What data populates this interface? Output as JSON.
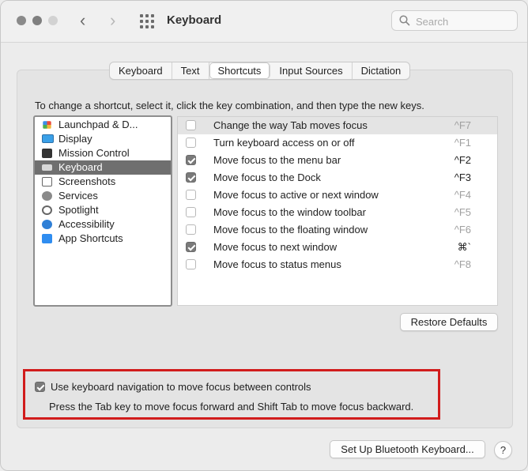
{
  "window": {
    "title": "Keyboard"
  },
  "search": {
    "placeholder": "Search"
  },
  "tabs": [
    {
      "label": "Keyboard",
      "active": false
    },
    {
      "label": "Text",
      "active": false
    },
    {
      "label": "Shortcuts",
      "active": true
    },
    {
      "label": "Input Sources",
      "active": false
    },
    {
      "label": "Dictation",
      "active": false
    }
  ],
  "instructions": "To change a shortcut, select it, click the key combination, and then type the new keys.",
  "categories": [
    {
      "label": "Launchpad & D...",
      "icon": "launchpad-icon",
      "selected": false
    },
    {
      "label": "Display",
      "icon": "display-icon",
      "selected": false
    },
    {
      "label": "Mission Control",
      "icon": "mission-control-icon",
      "selected": false
    },
    {
      "label": "Keyboard",
      "icon": "keyboard-icon",
      "selected": true
    },
    {
      "label": "Screenshots",
      "icon": "screenshots-icon",
      "selected": false
    },
    {
      "label": "Services",
      "icon": "services-icon",
      "selected": false
    },
    {
      "label": "Spotlight",
      "icon": "spotlight-icon",
      "selected": false
    },
    {
      "label": "Accessibility",
      "icon": "accessibility-icon",
      "selected": false
    },
    {
      "label": "App Shortcuts",
      "icon": "app-shortcuts-icon",
      "selected": false
    }
  ],
  "shortcuts": [
    {
      "label": "Change the way Tab moves focus",
      "key": "^F7",
      "checked": false
    },
    {
      "label": "Turn keyboard access on or off",
      "key": "^F1",
      "checked": false
    },
    {
      "label": "Move focus to the menu bar",
      "key": "^F2",
      "checked": true
    },
    {
      "label": "Move focus to the Dock",
      "key": "^F3",
      "checked": true
    },
    {
      "label": "Move focus to active or next window",
      "key": "^F4",
      "checked": false
    },
    {
      "label": "Move focus to the window toolbar",
      "key": "^F5",
      "checked": false
    },
    {
      "label": "Move focus to the floating window",
      "key": "^F6",
      "checked": false
    },
    {
      "label": "Move focus to next window",
      "key": "⌘`",
      "checked": true
    },
    {
      "label": "Move focus to status menus",
      "key": "^F8",
      "checked": false
    }
  ],
  "restore_defaults": "Restore Defaults",
  "keyboard_navigation": {
    "checked": true,
    "label": "Use keyboard navigation to move focus between controls",
    "hint": "Press the Tab key to move focus forward and Shift Tab to move focus backward."
  },
  "bluetooth_button": "Set Up Bluetooth Keyboard...",
  "help_label": "?",
  "colors": {
    "highlight_border": "#d11c1c",
    "selected_row": "#6f6f6f",
    "checkbox_on": "#7a7a7a"
  }
}
